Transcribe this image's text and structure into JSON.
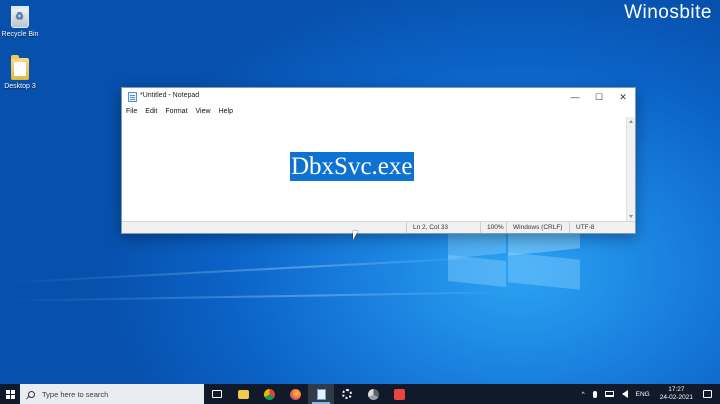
{
  "watermark": "Winosbite",
  "desktop_icons": [
    {
      "label": "Recycle Bin",
      "icon": "recycle-bin-icon"
    },
    {
      "label": "Desktop 3",
      "icon": "folder-icon"
    }
  ],
  "notepad": {
    "title": "*Untitled - Notepad",
    "controls": {
      "minimize": "—",
      "maximize": "☐",
      "close": "✕"
    },
    "menu": [
      "File",
      "Edit",
      "Format",
      "View",
      "Help"
    ],
    "content": "DbxSvc.exe",
    "status": {
      "position": "Ln 2, Col 33",
      "zoom": "100%",
      "line_ending": "Windows (CRLF)",
      "encoding": "UTF-8"
    }
  },
  "taskbar": {
    "search_placeholder": "Type here to search",
    "apps": [
      {
        "name": "task-view",
        "icon": "task-view-icon"
      },
      {
        "name": "file-explorer",
        "icon": "folder-icon"
      },
      {
        "name": "chrome",
        "icon": "chrome-icon"
      },
      {
        "name": "firefox",
        "icon": "firefox-icon"
      },
      {
        "name": "notepad",
        "icon": "notepad-icon",
        "active": true
      },
      {
        "name": "settings",
        "icon": "gear-icon"
      },
      {
        "name": "chrome-dev",
        "icon": "chrome-dev-icon"
      },
      {
        "name": "app",
        "icon": "app-icon"
      }
    ],
    "tray": {
      "chevron": "^",
      "language": "ENG",
      "time": "17:27",
      "date": "24-02-2021"
    }
  },
  "colors": {
    "selection": "#0e72d0",
    "taskbar": "#111a2b",
    "desktop": "#0b62c6"
  }
}
